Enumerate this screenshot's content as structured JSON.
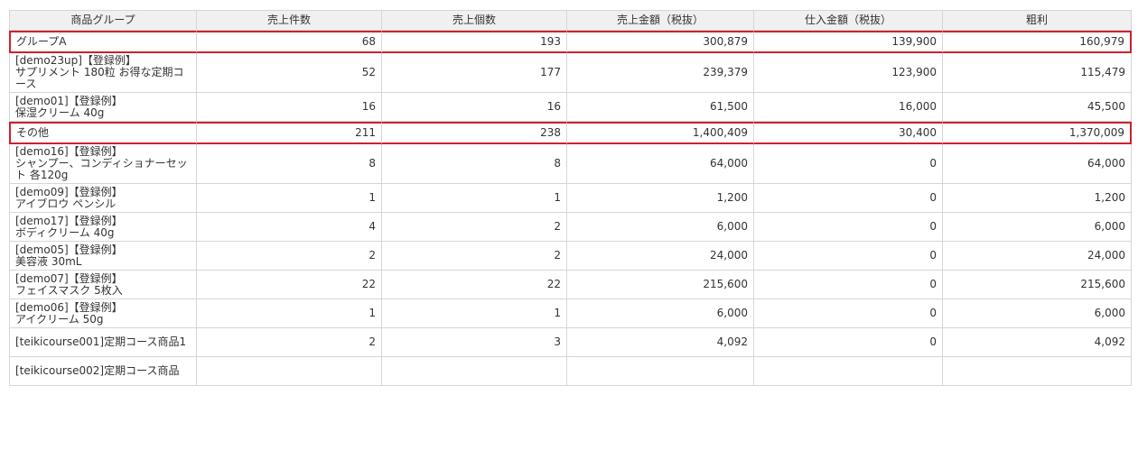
{
  "headers": [
    "商品グループ",
    "売上件数",
    "売上個数",
    "売上金額（税抜）",
    "仕入金額（税抜）",
    "粗利"
  ],
  "rows": [
    {
      "name": "グループA",
      "count": "68",
      "qty": "193",
      "sales": "300,879",
      "cost": "139,900",
      "profit": "160,979",
      "group": true
    },
    {
      "name": "[demo23up]【登録例】\nサプリメント 180粒 お得な定期コース",
      "count": "52",
      "qty": "177",
      "sales": "239,379",
      "cost": "123,900",
      "profit": "115,479",
      "group": false
    },
    {
      "name": "[demo01]【登録例】\n保湿クリーム 40g",
      "count": "16",
      "qty": "16",
      "sales": "61,500",
      "cost": "16,000",
      "profit": "45,500",
      "group": false
    },
    {
      "name": "その他",
      "count": "211",
      "qty": "238",
      "sales": "1,400,409",
      "cost": "30,400",
      "profit": "1,370,009",
      "group": true
    },
    {
      "name": "[demo16]【登録例】\nシャンプー、コンディショナーセット 各120g",
      "count": "8",
      "qty": "8",
      "sales": "64,000",
      "cost": "0",
      "profit": "64,000",
      "group": false
    },
    {
      "name": "[demo09]【登録例】\nアイブロウ ペンシル",
      "count": "1",
      "qty": "1",
      "sales": "1,200",
      "cost": "0",
      "profit": "1,200",
      "group": false
    },
    {
      "name": "[demo17]【登録例】\nボディクリーム 40g",
      "count": "4",
      "qty": "2",
      "sales": "6,000",
      "cost": "0",
      "profit": "6,000",
      "group": false
    },
    {
      "name": "[demo05]【登録例】\n美容液 30mL",
      "count": "2",
      "qty": "2",
      "sales": "24,000",
      "cost": "0",
      "profit": "24,000",
      "group": false
    },
    {
      "name": "[demo07]【登録例】\nフェイスマスク 5枚入",
      "count": "22",
      "qty": "22",
      "sales": "215,600",
      "cost": "0",
      "profit": "215,600",
      "group": false
    },
    {
      "name": "[demo06]【登録例】\nアイクリーム 50g",
      "count": "1",
      "qty": "1",
      "sales": "6,000",
      "cost": "0",
      "profit": "6,000",
      "group": false
    },
    {
      "name": "[teikicourse001]定期コース商品1",
      "count": "2",
      "qty": "3",
      "sales": "4,092",
      "cost": "0",
      "profit": "4,092",
      "group": false
    },
    {
      "name": "[teikicourse002]定期コース商品",
      "count": "",
      "qty": "",
      "sales": "",
      "cost": "",
      "profit": "",
      "group": false
    }
  ],
  "colors": {
    "group_border": "#d0202c",
    "header_bg": "#f0f0f0",
    "grid": "#d6d6d6"
  }
}
